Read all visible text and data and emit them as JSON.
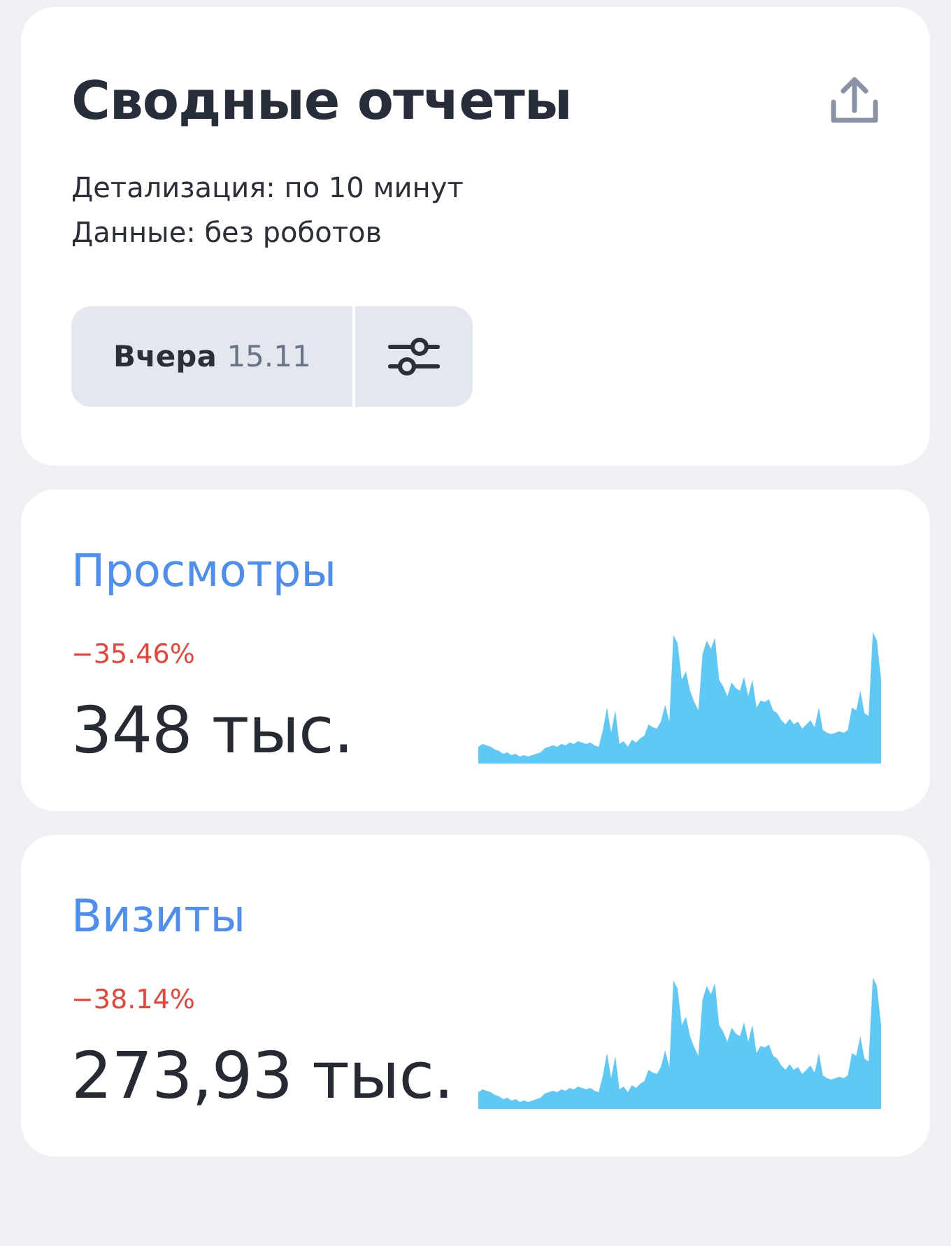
{
  "header": {
    "title": "Сводные отчеты",
    "details": [
      "Детализация: по 10 минут",
      "Данные: без роботов"
    ],
    "period": {
      "label": "Вчера",
      "date": "15.11"
    }
  },
  "metrics": [
    {
      "name": "Просмотры",
      "change": "−35.46%",
      "value": "348 тыс."
    },
    {
      "name": "Визиты",
      "change": "−38.14%",
      "value": "273,93 тыс."
    }
  ]
}
